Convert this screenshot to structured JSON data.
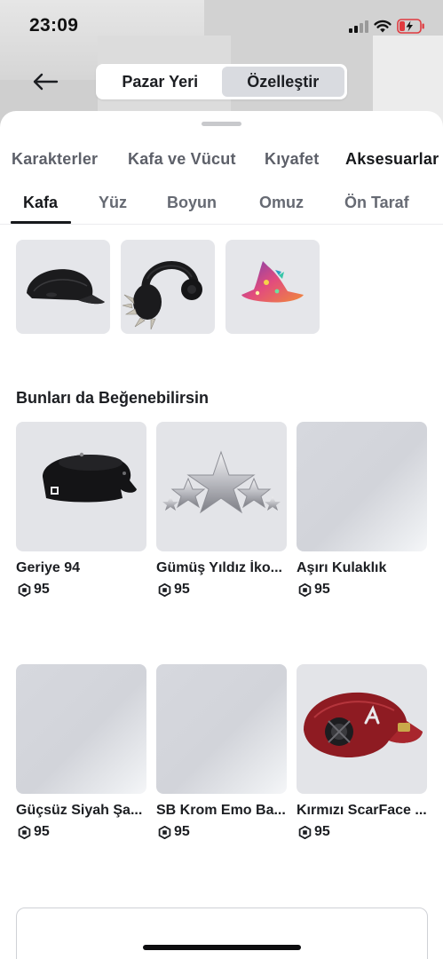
{
  "status_bar": {
    "time": "23:09"
  },
  "header": {
    "segments": [
      {
        "label": "Pazar Yeri",
        "active": false
      },
      {
        "label": "Özelleştir",
        "active": true
      }
    ]
  },
  "category_tabs": [
    {
      "label": "Karakterler",
      "active": false
    },
    {
      "label": "Kafa ve Vücut",
      "active": false
    },
    {
      "label": "Kıyafet",
      "active": false
    },
    {
      "label": "Aksesuarlar",
      "active": true
    }
  ],
  "sub_tabs": [
    {
      "label": "Kafa",
      "active": true
    },
    {
      "label": "Yüz",
      "active": false
    },
    {
      "label": "Boyun",
      "active": false
    },
    {
      "label": "Omuz",
      "active": false
    },
    {
      "label": "Ön Taraf",
      "active": false
    }
  ],
  "equipped_items": [
    {
      "icon": "black-cap-icon"
    },
    {
      "icon": "spiked-headphones-icon"
    },
    {
      "icon": "wizard-hat-icon"
    }
  ],
  "recommendations": {
    "title": "Bunları da Beğenebilirsin",
    "items": [
      {
        "name": "Geriye 94",
        "price": "95",
        "icon": "backwards-cap-icon"
      },
      {
        "name": "Gümüş Yıldız İko...",
        "price": "95",
        "icon": "silver-stars-icon"
      },
      {
        "name": "Aşırı Kulaklık",
        "price": "95",
        "icon": "placeholder"
      },
      {
        "name": "Güçsüz Siyah Şa...",
        "price": "95",
        "icon": "placeholder"
      },
      {
        "name": "SB Krom Emo Ba...",
        "price": "95",
        "icon": "placeholder"
      },
      {
        "name": "Kırmızı ScarFace ...",
        "price": "95",
        "icon": "red-cap-icon"
      }
    ]
  },
  "colors": {
    "accent_text": "#17191c",
    "inactive_text": "#5d6069",
    "segment_active_bg": "#d9dbe0",
    "thumb_bg": "#e3e4e8"
  }
}
